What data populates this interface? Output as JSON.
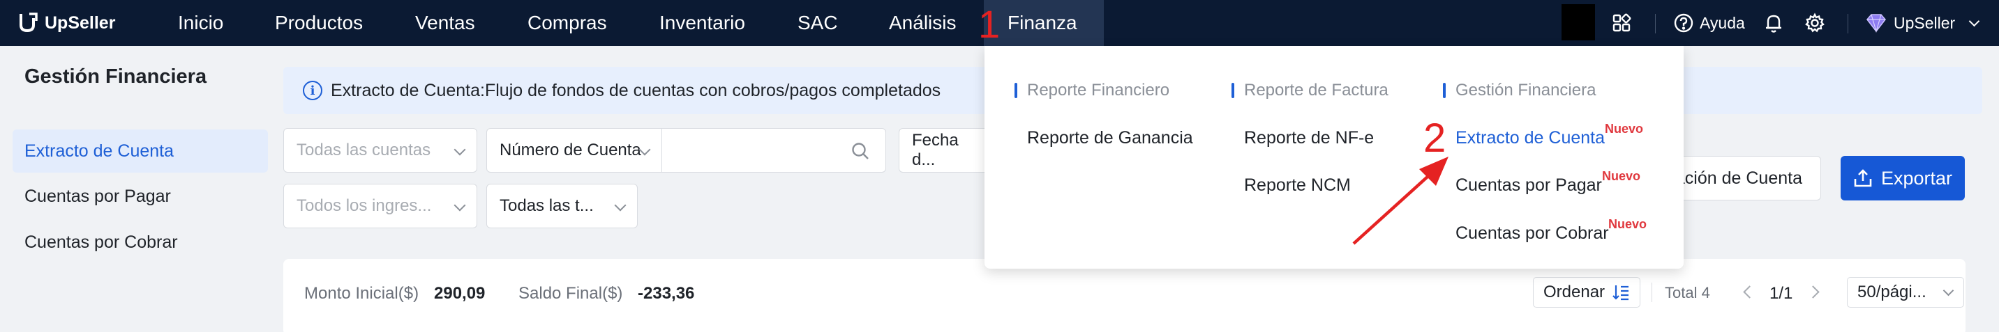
{
  "brand": {
    "name": "UpSeller"
  },
  "nav": {
    "items": [
      "Inicio",
      "Productos",
      "Ventas",
      "Compras",
      "Inventario",
      "SAC",
      "Análisis",
      "Finanza"
    ],
    "active": "Finanza"
  },
  "tools": {
    "help_label": "Ayuda",
    "account_label": "UpSeller"
  },
  "annotations": {
    "step1": "1",
    "step2": "2"
  },
  "sidebar": {
    "title": "Gestión Financiera",
    "items": [
      "Extracto de Cuenta",
      "Cuentas por Pagar",
      "Cuentas por Cobrar"
    ],
    "active_index": 0
  },
  "banner": {
    "text": "Extracto de Cuenta:Flujo de fondos de cuentas con cobros/pagos completados"
  },
  "filters": {
    "accounts_placeholder": "Todas las cuentas",
    "account_number_label": "Número de Cuenta",
    "search_placeholder": "",
    "date_label": "Fecha d...",
    "income_placeholder": "Todos los ingres...",
    "types_label": "Todas las t..."
  },
  "actions": {
    "reconcile_label": "ación de Cuenta",
    "export_label": "Exportar"
  },
  "summary": {
    "initial_label": "Monto Inicial($)",
    "initial_value": "290,09",
    "final_label": "Saldo Final($)",
    "final_value": "-233,36",
    "sort_label": "Ordenar",
    "total_label": "Total 4",
    "page_label": "1/1",
    "page_size_label": "50/pági..."
  },
  "dropdown": {
    "columns": [
      {
        "heading": "Reporte Financiero",
        "items": [
          {
            "label": "Reporte de Ganancia",
            "badge": ""
          }
        ]
      },
      {
        "heading": "Reporte de Factura",
        "items": [
          {
            "label": "Reporte de NF-e",
            "badge": ""
          },
          {
            "label": "Reporte NCM",
            "badge": ""
          }
        ]
      },
      {
        "heading": "Gestión Financiera",
        "items": [
          {
            "label": "Extracto de Cuenta",
            "badge": "Nuevo"
          },
          {
            "label": "Cuentas por Pagar",
            "badge": "Nuevo"
          },
          {
            "label": "Cuentas por Cobrar",
            "badge": "Nuevo"
          }
        ]
      }
    ]
  },
  "colors": {
    "nav_bg": "#0b1a33",
    "accent": "#1e5fd6",
    "primary_button": "#1658d6",
    "badge": "#e0383e",
    "annotation": "#e52222"
  },
  "icons": [
    "upseller-logo-icon",
    "apps-grid-icon",
    "help-circle-icon",
    "bell-icon",
    "gear-icon",
    "diamond-icon",
    "info-icon",
    "search-icon",
    "export-icon",
    "sort-icon"
  ]
}
